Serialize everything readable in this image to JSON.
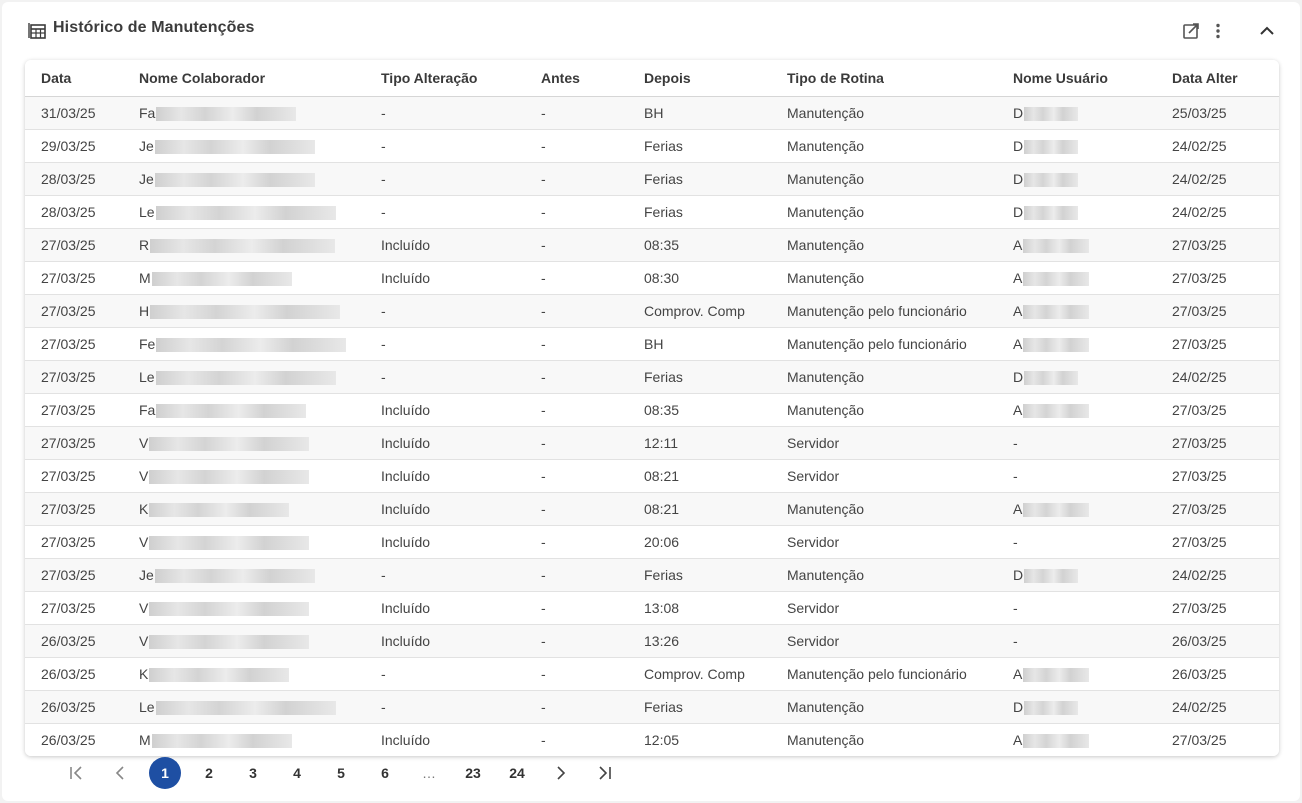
{
  "widget": {
    "title": "Histórico de Manutenções",
    "icons": [
      "table-icon",
      "open-external-icon",
      "more-vert-icon",
      "chevron-up-icon"
    ]
  },
  "table": {
    "columns": [
      "Data",
      "Nome Colaborador",
      "Tipo Alteração",
      "Antes",
      "Depois",
      "Tipo de Rotina",
      "Nome Usuário",
      "Data Alter"
    ],
    "rows": [
      {
        "data": "31/03/25",
        "nome": "Fa",
        "tipo": "-",
        "antes": "-",
        "depois": "BH",
        "rotina": "Manutenção",
        "usuario": "D",
        "alter": "25/03/25"
      },
      {
        "data": "29/03/25",
        "nome": "Je",
        "tipo": "-",
        "antes": "-",
        "depois": "Ferias",
        "rotina": "Manutenção",
        "usuario": "D",
        "alter": "24/02/25"
      },
      {
        "data": "28/03/25",
        "nome": "Je",
        "tipo": "-",
        "antes": "-",
        "depois": "Ferias",
        "rotina": "Manutenção",
        "usuario": "D",
        "alter": "24/02/25"
      },
      {
        "data": "28/03/25",
        "nome": "Le",
        "tipo": "-",
        "antes": "-",
        "depois": "Ferias",
        "rotina": "Manutenção",
        "usuario": "D",
        "alter": "24/02/25"
      },
      {
        "data": "27/03/25",
        "nome": "R",
        "tipo": "Incluído",
        "antes": "-",
        "depois": "08:35",
        "rotina": "Manutenção",
        "usuario": "A",
        "alter": "27/03/25"
      },
      {
        "data": "27/03/25",
        "nome": "M",
        "tipo": "Incluído",
        "antes": "-",
        "depois": "08:30",
        "rotina": "Manutenção",
        "usuario": "A",
        "alter": "27/03/25"
      },
      {
        "data": "27/03/25",
        "nome": "H",
        "tipo": "-",
        "antes": "-",
        "depois": "Comprov. Comp",
        "rotina": "Manutenção pelo funcionário",
        "usuario": "A",
        "alter": "27/03/25"
      },
      {
        "data": "27/03/25",
        "nome": "Fe",
        "tipo": "-",
        "antes": "-",
        "depois": "BH",
        "rotina": "Manutenção pelo funcionário",
        "usuario": "A",
        "alter": "27/03/25"
      },
      {
        "data": "27/03/25",
        "nome": "Le",
        "tipo": "-",
        "antes": "-",
        "depois": "Ferias",
        "rotina": "Manutenção",
        "usuario": "D",
        "alter": "24/02/25"
      },
      {
        "data": "27/03/25",
        "nome": "Fa",
        "tipo": "Incluído",
        "antes": "-",
        "depois": "08:35",
        "rotina": "Manutenção",
        "usuario": "A",
        "alter": "27/03/25"
      },
      {
        "data": "27/03/25",
        "nome": "V",
        "tipo": "Incluído",
        "antes": "-",
        "depois": "12:11",
        "rotina": "Servidor",
        "usuario": "-",
        "alter": "27/03/25"
      },
      {
        "data": "27/03/25",
        "nome": "V",
        "tipo": "Incluído",
        "antes": "-",
        "depois": "08:21",
        "rotina": "Servidor",
        "usuario": "-",
        "alter": "27/03/25"
      },
      {
        "data": "27/03/25",
        "nome": "K",
        "tipo": "Incluído",
        "antes": "-",
        "depois": "08:21",
        "rotina": "Manutenção",
        "usuario": "A",
        "alter": "27/03/25"
      },
      {
        "data": "27/03/25",
        "nome": "V",
        "tipo": "Incluído",
        "antes": "-",
        "depois": "20:06",
        "rotina": "Servidor",
        "usuario": "-",
        "alter": "27/03/25"
      },
      {
        "data": "27/03/25",
        "nome": "Je",
        "tipo": "-",
        "antes": "-",
        "depois": "Ferias",
        "rotina": "Manutenção",
        "usuario": "D",
        "alter": "24/02/25"
      },
      {
        "data": "27/03/25",
        "nome": "V",
        "tipo": "Incluído",
        "antes": "-",
        "depois": "13:08",
        "rotina": "Servidor",
        "usuario": "-",
        "alter": "27/03/25"
      },
      {
        "data": "26/03/25",
        "nome": "V",
        "tipo": "Incluído",
        "antes": "-",
        "depois": "13:26",
        "rotina": "Servidor",
        "usuario": "-",
        "alter": "26/03/25"
      },
      {
        "data": "26/03/25",
        "nome": "K",
        "tipo": "-",
        "antes": "-",
        "depois": "Comprov. Comp",
        "rotina": "Manutenção pelo funcionário",
        "usuario": "A",
        "alter": "26/03/25"
      },
      {
        "data": "26/03/25",
        "nome": "Le",
        "tipo": "-",
        "antes": "-",
        "depois": "Ferias",
        "rotina": "Manutenção",
        "usuario": "D",
        "alter": "24/02/25"
      },
      {
        "data": "26/03/25",
        "nome": "M",
        "tipo": "Incluído",
        "antes": "-",
        "depois": "12:05",
        "rotina": "Manutenção",
        "usuario": "A",
        "alter": "27/03/25"
      }
    ]
  },
  "pagination": {
    "pages": [
      "1",
      "2",
      "3",
      "4",
      "5",
      "6",
      "…",
      "23",
      "24"
    ],
    "current": "1"
  }
}
